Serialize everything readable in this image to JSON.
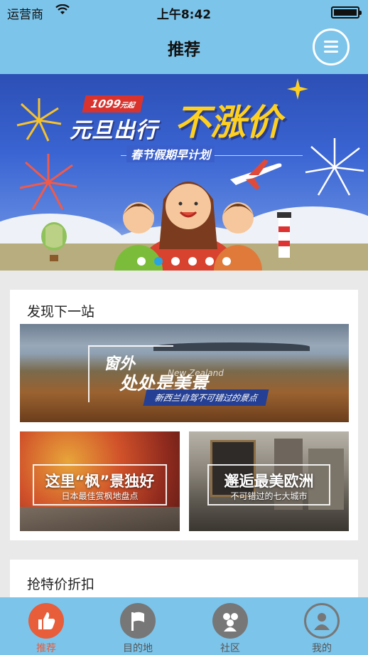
{
  "status_bar": {
    "carrier": "运营商",
    "time": "上午8:42"
  },
  "nav": {
    "title": "推荐",
    "menu_icon": "menu-icon"
  },
  "banner": {
    "price_tag_value": "1099",
    "price_tag_unit": "元起",
    "headline_part1": "元旦出行",
    "headline_part2": "不涨价",
    "tagline": "春节假期早计划",
    "page_count": 6,
    "active_page": 2
  },
  "discover": {
    "title": "发现下一站",
    "featured": {
      "line1": "窗外",
      "line2": "处处是美景",
      "english": "New Zealand",
      "caption": "新西兰自驾不可错过的景点"
    },
    "tiles": [
      {
        "title": "这里“枫”景独好",
        "subtitle": "日本最佳赏枫地盘点"
      },
      {
        "title": "邂逅最美欧洲",
        "subtitle": "不可错过的七大城市"
      }
    ]
  },
  "deals": {
    "title": "抢特价折扣"
  },
  "tabs": [
    {
      "label": "推荐",
      "icon": "thumbs-up-icon",
      "active": true
    },
    {
      "label": "目的地",
      "icon": "flag-icon",
      "active": false
    },
    {
      "label": "社区",
      "icon": "people-icon",
      "active": false
    },
    {
      "label": "我的",
      "icon": "user-icon",
      "active": false
    }
  ],
  "colors": {
    "bar": "#7cc4ea",
    "active_tab": "#e85d3a",
    "active_dot": "#2aa4e0"
  }
}
